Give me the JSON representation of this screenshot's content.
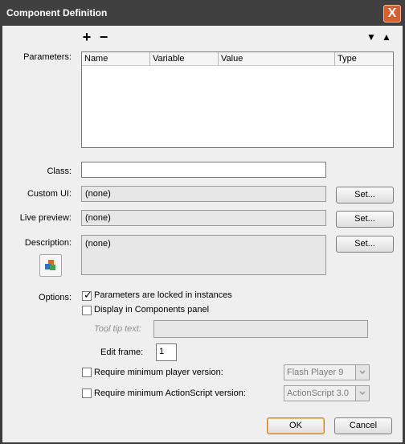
{
  "window": {
    "title": "Component Definition",
    "close_label": "X"
  },
  "toolbar": {
    "add": "+",
    "remove": "−",
    "move_down": "▼",
    "move_up": "▲"
  },
  "params": {
    "label": "Parameters:",
    "columns": [
      "Name",
      "Variable",
      "Value",
      "Type"
    ]
  },
  "class": {
    "label": "Class:",
    "value": ""
  },
  "custom_ui": {
    "label": "Custom UI:",
    "value": "(none)",
    "button": "Set..."
  },
  "live_preview": {
    "label": "Live preview:",
    "value": "(none)",
    "button": "Set..."
  },
  "description": {
    "label": "Description:",
    "value": "(none)",
    "button": "Set..."
  },
  "options": {
    "label": "Options:",
    "locked": {
      "label": "Parameters are locked in instances",
      "checked": true
    },
    "display_in_panel": {
      "label": "Display in Components panel",
      "checked": false
    },
    "tooltip": {
      "label": "Tool tip text:",
      "value": ""
    },
    "edit_frame": {
      "label": "Edit frame:",
      "value": "1"
    },
    "min_player": {
      "label": "Require minimum player version:",
      "checked": false,
      "selected": "Flash Player 9"
    },
    "min_as": {
      "label": "Require minimum ActionScript version:",
      "checked": false,
      "selected": "ActionScript 3.0"
    }
  },
  "buttons": {
    "ok": "OK",
    "cancel": "Cancel"
  }
}
